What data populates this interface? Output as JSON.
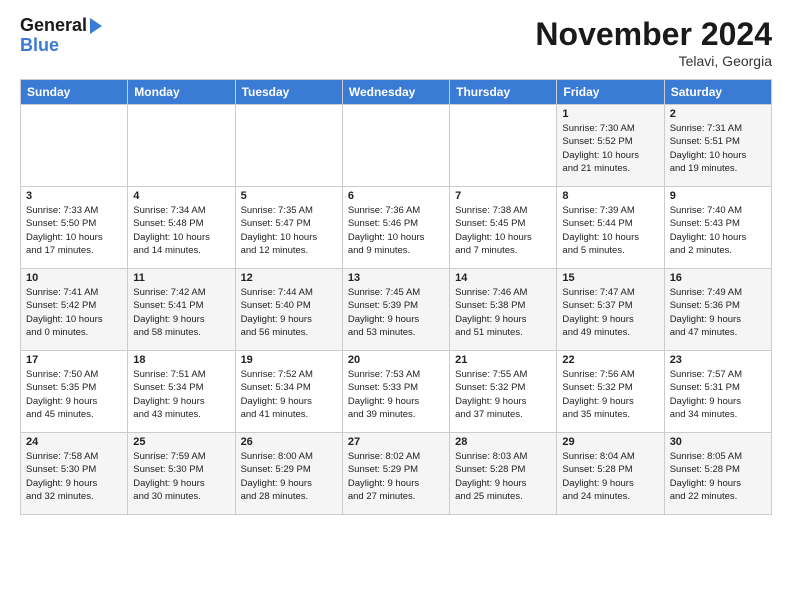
{
  "header": {
    "logo_line1": "General",
    "logo_line2": "Blue",
    "month": "November 2024",
    "location": "Telavi, Georgia"
  },
  "days_of_week": [
    "Sunday",
    "Monday",
    "Tuesday",
    "Wednesday",
    "Thursday",
    "Friday",
    "Saturday"
  ],
  "weeks": [
    [
      {
        "day": "",
        "info": ""
      },
      {
        "day": "",
        "info": ""
      },
      {
        "day": "",
        "info": ""
      },
      {
        "day": "",
        "info": ""
      },
      {
        "day": "",
        "info": ""
      },
      {
        "day": "1",
        "info": "Sunrise: 7:30 AM\nSunset: 5:52 PM\nDaylight: 10 hours\nand 21 minutes."
      },
      {
        "day": "2",
        "info": "Sunrise: 7:31 AM\nSunset: 5:51 PM\nDaylight: 10 hours\nand 19 minutes."
      }
    ],
    [
      {
        "day": "3",
        "info": "Sunrise: 7:33 AM\nSunset: 5:50 PM\nDaylight: 10 hours\nand 17 minutes."
      },
      {
        "day": "4",
        "info": "Sunrise: 7:34 AM\nSunset: 5:48 PM\nDaylight: 10 hours\nand 14 minutes."
      },
      {
        "day": "5",
        "info": "Sunrise: 7:35 AM\nSunset: 5:47 PM\nDaylight: 10 hours\nand 12 minutes."
      },
      {
        "day": "6",
        "info": "Sunrise: 7:36 AM\nSunset: 5:46 PM\nDaylight: 10 hours\nand 9 minutes."
      },
      {
        "day": "7",
        "info": "Sunrise: 7:38 AM\nSunset: 5:45 PM\nDaylight: 10 hours\nand 7 minutes."
      },
      {
        "day": "8",
        "info": "Sunrise: 7:39 AM\nSunset: 5:44 PM\nDaylight: 10 hours\nand 5 minutes."
      },
      {
        "day": "9",
        "info": "Sunrise: 7:40 AM\nSunset: 5:43 PM\nDaylight: 10 hours\nand 2 minutes."
      }
    ],
    [
      {
        "day": "10",
        "info": "Sunrise: 7:41 AM\nSunset: 5:42 PM\nDaylight: 10 hours\nand 0 minutes."
      },
      {
        "day": "11",
        "info": "Sunrise: 7:42 AM\nSunset: 5:41 PM\nDaylight: 9 hours\nand 58 minutes."
      },
      {
        "day": "12",
        "info": "Sunrise: 7:44 AM\nSunset: 5:40 PM\nDaylight: 9 hours\nand 56 minutes."
      },
      {
        "day": "13",
        "info": "Sunrise: 7:45 AM\nSunset: 5:39 PM\nDaylight: 9 hours\nand 53 minutes."
      },
      {
        "day": "14",
        "info": "Sunrise: 7:46 AM\nSunset: 5:38 PM\nDaylight: 9 hours\nand 51 minutes."
      },
      {
        "day": "15",
        "info": "Sunrise: 7:47 AM\nSunset: 5:37 PM\nDaylight: 9 hours\nand 49 minutes."
      },
      {
        "day": "16",
        "info": "Sunrise: 7:49 AM\nSunset: 5:36 PM\nDaylight: 9 hours\nand 47 minutes."
      }
    ],
    [
      {
        "day": "17",
        "info": "Sunrise: 7:50 AM\nSunset: 5:35 PM\nDaylight: 9 hours\nand 45 minutes."
      },
      {
        "day": "18",
        "info": "Sunrise: 7:51 AM\nSunset: 5:34 PM\nDaylight: 9 hours\nand 43 minutes."
      },
      {
        "day": "19",
        "info": "Sunrise: 7:52 AM\nSunset: 5:34 PM\nDaylight: 9 hours\nand 41 minutes."
      },
      {
        "day": "20",
        "info": "Sunrise: 7:53 AM\nSunset: 5:33 PM\nDaylight: 9 hours\nand 39 minutes."
      },
      {
        "day": "21",
        "info": "Sunrise: 7:55 AM\nSunset: 5:32 PM\nDaylight: 9 hours\nand 37 minutes."
      },
      {
        "day": "22",
        "info": "Sunrise: 7:56 AM\nSunset: 5:32 PM\nDaylight: 9 hours\nand 35 minutes."
      },
      {
        "day": "23",
        "info": "Sunrise: 7:57 AM\nSunset: 5:31 PM\nDaylight: 9 hours\nand 34 minutes."
      }
    ],
    [
      {
        "day": "24",
        "info": "Sunrise: 7:58 AM\nSunset: 5:30 PM\nDaylight: 9 hours\nand 32 minutes."
      },
      {
        "day": "25",
        "info": "Sunrise: 7:59 AM\nSunset: 5:30 PM\nDaylight: 9 hours\nand 30 minutes."
      },
      {
        "day": "26",
        "info": "Sunrise: 8:00 AM\nSunset: 5:29 PM\nDaylight: 9 hours\nand 28 minutes."
      },
      {
        "day": "27",
        "info": "Sunrise: 8:02 AM\nSunset: 5:29 PM\nDaylight: 9 hours\nand 27 minutes."
      },
      {
        "day": "28",
        "info": "Sunrise: 8:03 AM\nSunset: 5:28 PM\nDaylight: 9 hours\nand 25 minutes."
      },
      {
        "day": "29",
        "info": "Sunrise: 8:04 AM\nSunset: 5:28 PM\nDaylight: 9 hours\nand 24 minutes."
      },
      {
        "day": "30",
        "info": "Sunrise: 8:05 AM\nSunset: 5:28 PM\nDaylight: 9 hours\nand 22 minutes."
      }
    ]
  ]
}
